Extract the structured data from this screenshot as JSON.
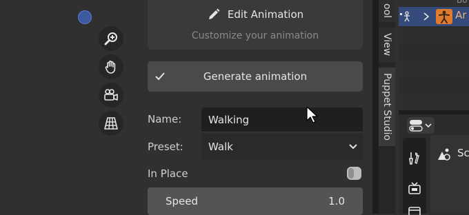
{
  "edit": {
    "title": "Edit Animation",
    "subtitle": "Customize your animation"
  },
  "generate": {
    "label": "Generate animation"
  },
  "fields": {
    "name_label": "Name:",
    "name_value": "Walking",
    "preset_label": "Preset:",
    "preset_value": "Walk",
    "in_place_label": "In Place",
    "speed_label": "Speed",
    "speed_value": "1.0"
  },
  "tabs": {
    "tool": "ool",
    "view": "View",
    "puppet": "Puppet Studio"
  },
  "outliner": {
    "top_text": "Bo",
    "row_text": "Ar"
  },
  "properties": {
    "label": "Sc"
  },
  "colors": {
    "accent": "#334a7a",
    "orange": "#e07b2e"
  }
}
